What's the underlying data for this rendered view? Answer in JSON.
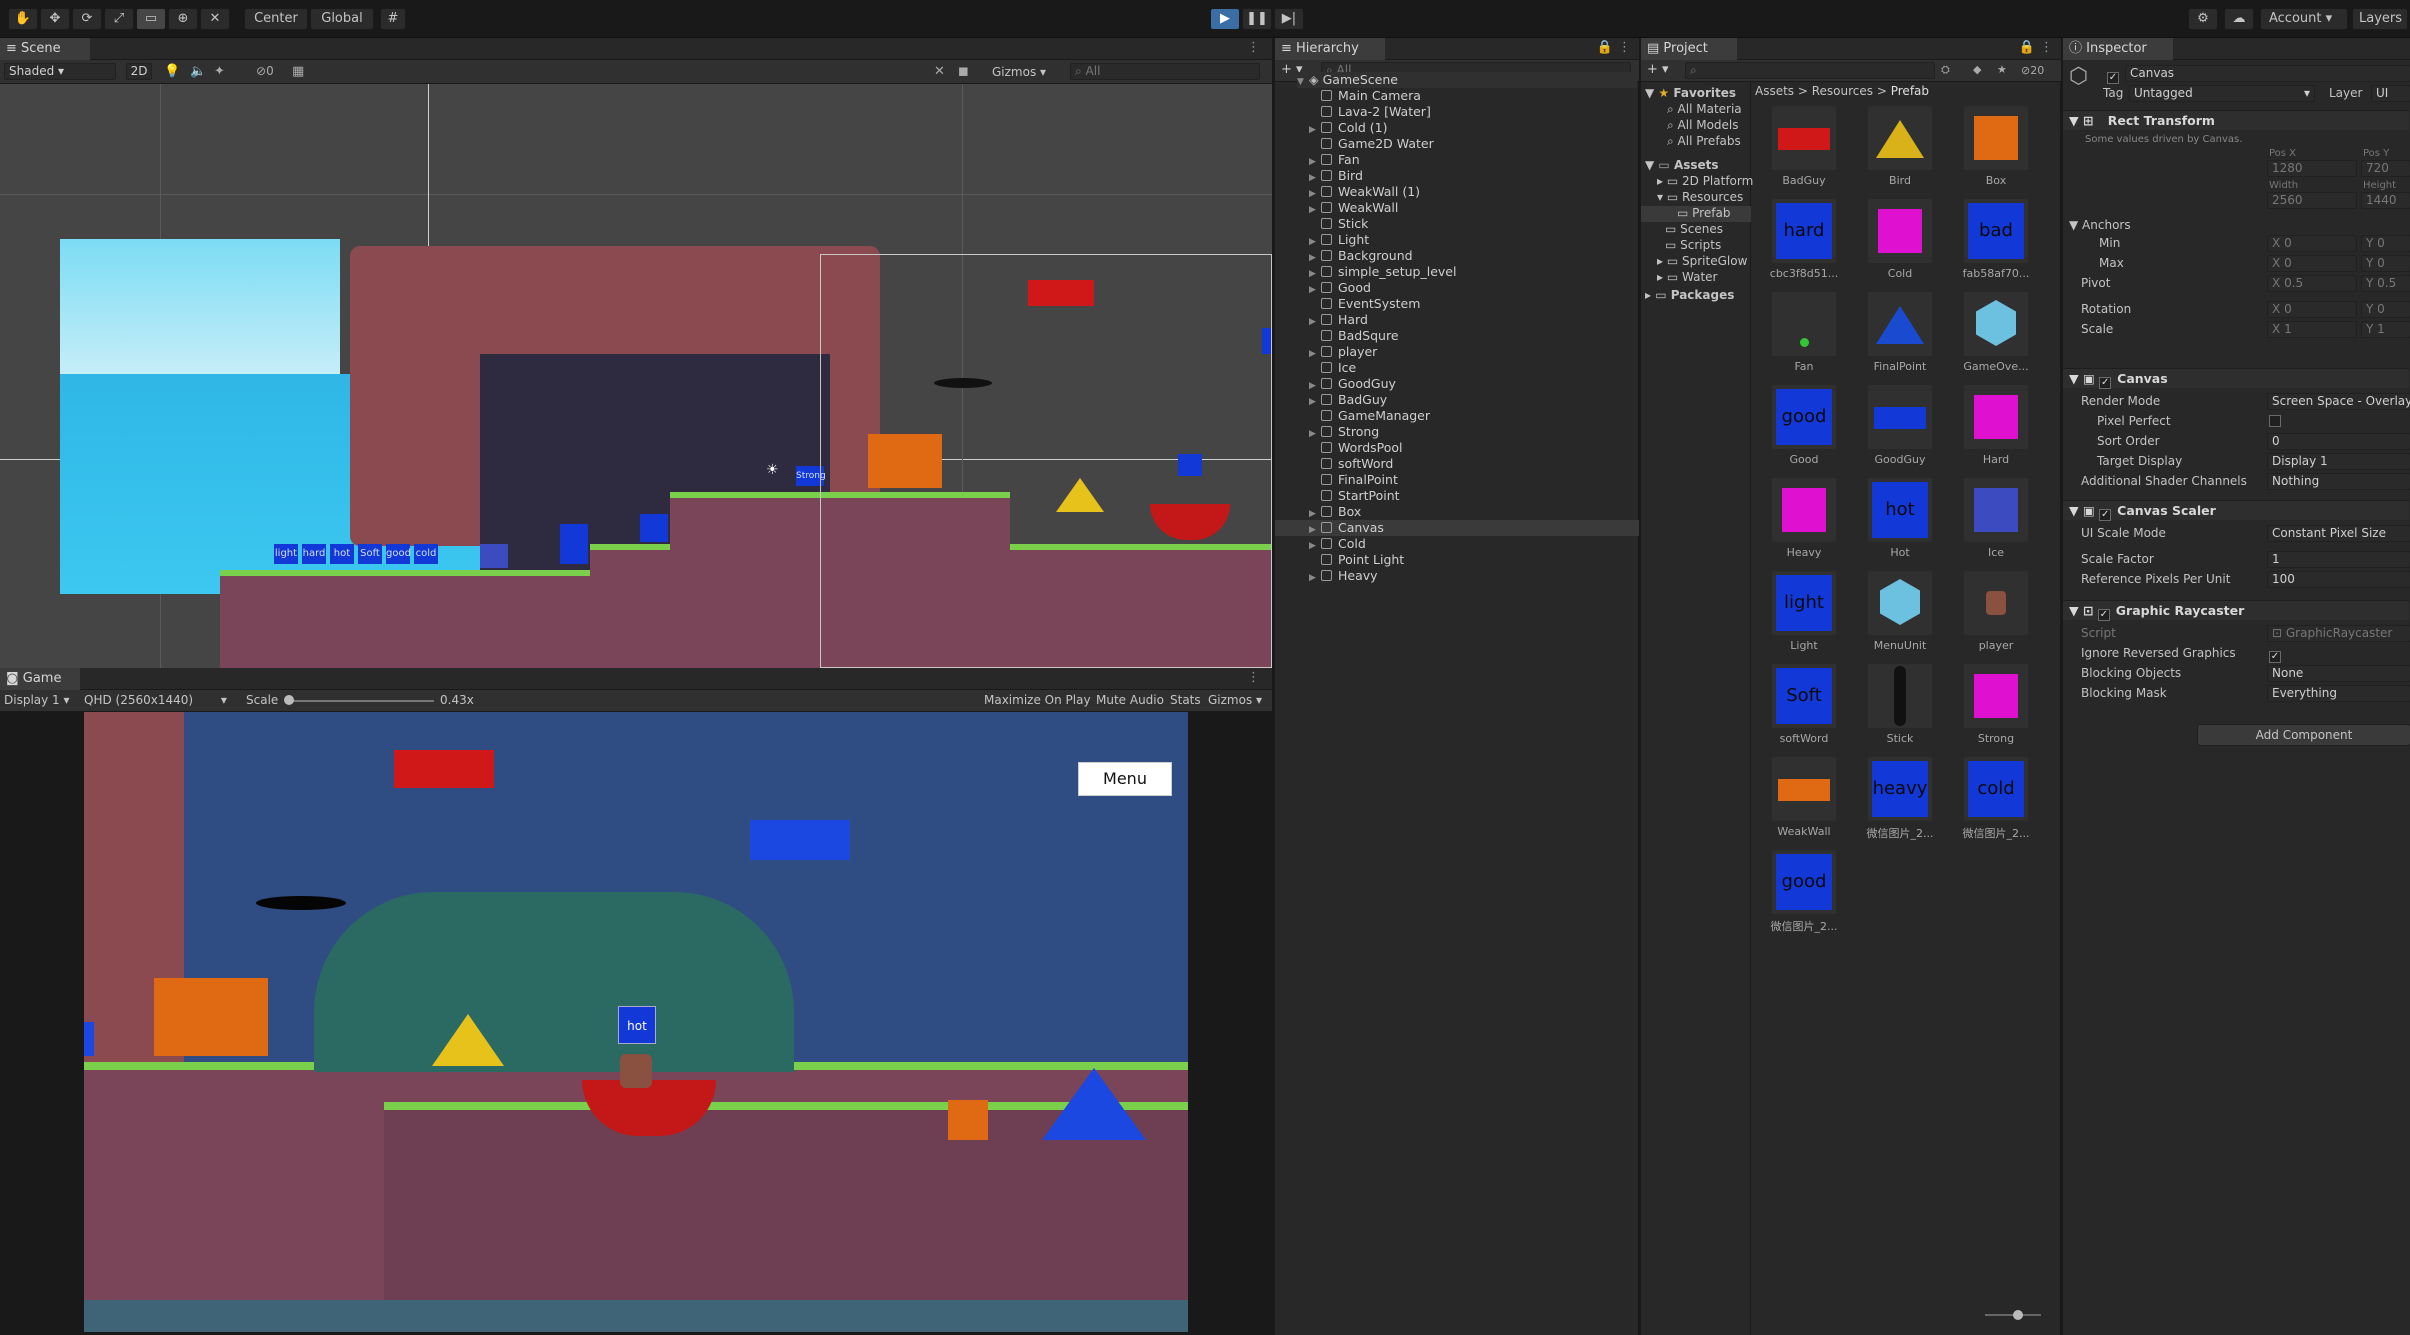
{
  "toolbar": {
    "pivot": "Center",
    "space": "Global",
    "account": "Account",
    "layers": "Layers"
  },
  "scene": {
    "tab": "Scene",
    "shading": "Shaded",
    "mode2d": "2D",
    "gizmos": "Gizmos",
    "search_placeholder": "All",
    "hidden_count": "0",
    "level_labels": [
      "light",
      "hard",
      "hot",
      "Soft",
      "good",
      "cold"
    ],
    "strong_label": "Strong"
  },
  "game": {
    "tab": "Game",
    "display": "Display 1",
    "resolution": "QHD (2560x1440)",
    "scale_label": "Scale",
    "scale_value": "0.43x",
    "maximize": "Maximize On Play",
    "mute": "Mute Audio",
    "stats": "Stats",
    "gizmos": "Gizmos",
    "menu_button": "Menu",
    "hot_label": "hot"
  },
  "hierarchy": {
    "tab": "Hierarchy",
    "search_placeholder": "All",
    "root": "GameScene",
    "items": [
      {
        "label": "Main Camera",
        "arrow": false
      },
      {
        "label": "Lava-2 [Water]",
        "arrow": false
      },
      {
        "label": "Cold (1)",
        "arrow": true
      },
      {
        "label": "Game2D Water",
        "arrow": false
      },
      {
        "label": "Fan",
        "arrow": true
      },
      {
        "label": "Bird",
        "arrow": true
      },
      {
        "label": "WeakWall (1)",
        "arrow": true
      },
      {
        "label": "WeakWall",
        "arrow": true
      },
      {
        "label": "Stick",
        "arrow": false
      },
      {
        "label": "Light",
        "arrow": true
      },
      {
        "label": "Background",
        "arrow": true
      },
      {
        "label": "simple_setup_level",
        "arrow": true
      },
      {
        "label": "Good",
        "arrow": true
      },
      {
        "label": "EventSystem",
        "arrow": false
      },
      {
        "label": "Hard",
        "arrow": true
      },
      {
        "label": "BadSqure",
        "arrow": false
      },
      {
        "label": "player",
        "arrow": true
      },
      {
        "label": "Ice",
        "arrow": false
      },
      {
        "label": "GoodGuy",
        "arrow": true
      },
      {
        "label": "BadGuy",
        "arrow": true
      },
      {
        "label": "GameManager",
        "arrow": false
      },
      {
        "label": "Strong",
        "arrow": true
      },
      {
        "label": "WordsPool",
        "arrow": false
      },
      {
        "label": "softWord",
        "arrow": false
      },
      {
        "label": "FinalPoint",
        "arrow": false
      },
      {
        "label": "StartPoint",
        "arrow": false
      },
      {
        "label": "Box",
        "arrow": true
      },
      {
        "label": "Canvas",
        "arrow": true
      },
      {
        "label": "Cold",
        "arrow": true
      },
      {
        "label": "Point Light",
        "arrow": false
      },
      {
        "label": "Heavy",
        "arrow": true
      }
    ]
  },
  "project": {
    "tab": "Project",
    "hidden_count": "20",
    "favorites": "Favorites",
    "fav_items": [
      "All Materia",
      "All Models",
      "All Prefabs"
    ],
    "assets": "Assets",
    "asset_folders": [
      "2D Platform",
      "Resources",
      "Prefab",
      "Scenes",
      "Scripts",
      "SpriteGlow",
      "Water"
    ],
    "packages": "Packages",
    "breadcrumb": [
      "Assets",
      "Resources",
      "Prefab"
    ],
    "items": [
      {
        "label": "BadGuy",
        "color": "#d01818",
        "shape": "bar"
      },
      {
        "label": "Bird",
        "color": "#d9b21a",
        "shape": "triangle"
      },
      {
        "label": "Box",
        "color": "#e06a14",
        "shape": "square"
      },
      {
        "label": "cbc3f8d51...",
        "color": "#1238d8",
        "shape": "word",
        "text": "hard"
      },
      {
        "label": "Cold",
        "color": "#e010d0",
        "shape": "square"
      },
      {
        "label": "fab58af70...",
        "color": "#1238d8",
        "shape": "word",
        "text": "bad"
      },
      {
        "label": "Fan",
        "color": "#303030",
        "shape": "dot"
      },
      {
        "label": "FinalPoint",
        "color": "#1a4ad0",
        "shape": "triangle"
      },
      {
        "label": "GameOve...",
        "color": "#6cc0e0",
        "shape": "cube"
      },
      {
        "label": "Good",
        "color": "#1238d8",
        "shape": "word",
        "text": "good"
      },
      {
        "label": "GoodGuy",
        "color": "#1238d8",
        "shape": "bar"
      },
      {
        "label": "Hard",
        "color": "#e010d0",
        "shape": "square"
      },
      {
        "label": "Heavy",
        "color": "#e010d0",
        "shape": "square"
      },
      {
        "label": "Hot",
        "color": "#1238d8",
        "shape": "word",
        "text": "hot"
      },
      {
        "label": "Ice",
        "color": "#3c4cc0",
        "shape": "square"
      },
      {
        "label": "Light",
        "color": "#1238d8",
        "shape": "word",
        "text": "light"
      },
      {
        "label": "MenuUnit",
        "color": "#6cc0e0",
        "shape": "cube"
      },
      {
        "label": "player",
        "color": "#8a5040",
        "shape": "sprite"
      },
      {
        "label": "softWord",
        "color": "#1238d8",
        "shape": "word",
        "text": "Soft"
      },
      {
        "label": "Stick",
        "color": "#111111",
        "shape": "stick"
      },
      {
        "label": "Strong",
        "color": "#e010d0",
        "shape": "square"
      },
      {
        "label": "WeakWall",
        "color": "#e06a14",
        "shape": "bar"
      },
      {
        "label": "微信图片_2...",
        "color": "#1238d8",
        "shape": "word",
        "text": "heavy"
      },
      {
        "label": "微信图片_2...",
        "color": "#1238d8",
        "shape": "word",
        "text": "cold"
      },
      {
        "label": "微信图片_2...",
        "color": "#1238d8",
        "shape": "word",
        "text": "good"
      }
    ]
  },
  "inspector": {
    "tab": "Inspector",
    "object_name": "Canvas",
    "tag_label": "Tag",
    "tag_value": "Untagged",
    "layer_label": "Layer",
    "layer_value": "UI",
    "rect_transform": "Rect Transform",
    "driven_note": "Some values driven by Canvas.",
    "pos_x_label": "Pos X",
    "pos_y_label": "Pos Y",
    "pos_x": "1280",
    "pos_y": "720",
    "width_label": "Width",
    "height_label": "Height",
    "width": "2560",
    "height": "1440",
    "anchors": "Anchors",
    "min": "Min",
    "max": "Max",
    "pivot": "Pivot",
    "rotation": "Rotation",
    "scale": "Scale",
    "x": "X",
    "y": "Y",
    "zero": "0",
    "half": "0.5",
    "one": "1",
    "canvas": "Canvas",
    "render_mode_label": "Render Mode",
    "render_mode": "Screen Space - Overlay",
    "pixel_perfect": "Pixel Perfect",
    "sort_order_label": "Sort Order",
    "sort_order": "0",
    "target_display_label": "Target Display",
    "target_display": "Display 1",
    "shader_channels_label": "Additional Shader Channels",
    "shader_channels": "Nothing",
    "canvas_scaler": "Canvas Scaler",
    "ui_scale_mode_label": "UI Scale Mode",
    "ui_scale_mode": "Constant Pixel Size",
    "scale_factor_label": "Scale Factor",
    "scale_factor": "1",
    "ref_ppu_label": "Reference Pixels Per Unit",
    "ref_ppu": "100",
    "graphic_raycaster": "Graphic Raycaster",
    "script_label": "Script",
    "script_value": "GraphicRaycaster",
    "ignore_reversed": "Ignore Reversed Graphics",
    "blocking_objects_label": "Blocking Objects",
    "blocking_objects": "None",
    "blocking_mask_label": "Blocking Mask",
    "blocking_mask": "Everything",
    "add_component": "Add Component"
  }
}
